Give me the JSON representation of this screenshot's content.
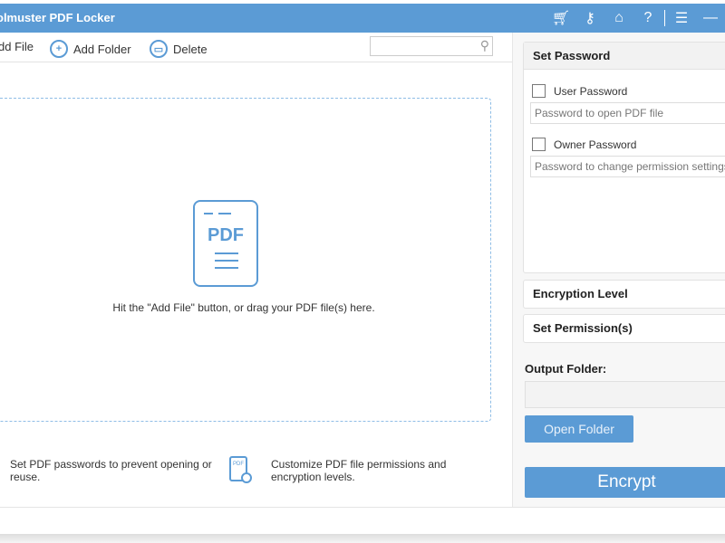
{
  "window": {
    "title": "olmuster PDF Locker",
    "icons": [
      "cart-icon",
      "key-icon",
      "home-icon",
      "help-icon",
      "feedback-icon",
      "minimize-icon"
    ]
  },
  "toolbar": {
    "add_file": "dd File",
    "add_folder": "Add Folder",
    "delete": "Delete",
    "search_placeholder": ""
  },
  "dropzone": {
    "icon_text": "PDF",
    "hint": "Hit the \"Add File\" button, or drag your PDF file(s) here."
  },
  "info": {
    "left": "Set PDF passwords to prevent opening or reuse.",
    "right": "Customize PDF file permissions and encryption levels.",
    "icon_text": "PDF"
  },
  "settings": {
    "set_password": "Set Password",
    "user_password": {
      "label": "User Password",
      "checked": false,
      "placeholder": "Password to open PDF file"
    },
    "owner_password": {
      "label": "Owner Password",
      "checked": false,
      "placeholder": "Password to change permission settings"
    },
    "encryption_level": "Encryption Level",
    "set_permissions": "Set Permission(s)",
    "output_folder_label": "Output Folder:",
    "output_folder_value": "",
    "open_folder": "Open Folder",
    "encrypt": "Encrypt"
  },
  "colors": {
    "accent": "#5b9bd5"
  }
}
